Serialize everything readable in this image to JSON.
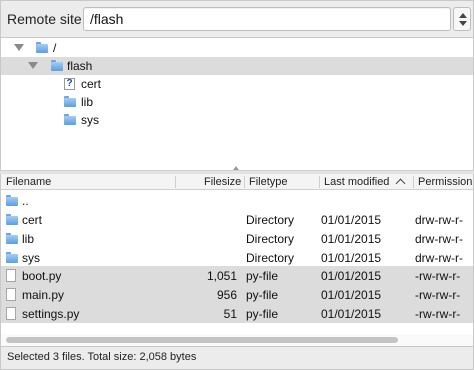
{
  "site_bar": {
    "label": "Remote site:",
    "path": "/flash"
  },
  "tree": {
    "items": [
      {
        "label": "/",
        "icon": "folder-icon",
        "expanded": true,
        "selected": false
      },
      {
        "label": "flash",
        "icon": "folder-icon",
        "expanded": true,
        "selected": true
      },
      {
        "label": "cert",
        "icon": "unknown-folder-icon",
        "expanded": false,
        "selected": false
      },
      {
        "label": "lib",
        "icon": "folder-icon",
        "expanded": false,
        "selected": false
      },
      {
        "label": "sys",
        "icon": "folder-icon",
        "expanded": false,
        "selected": false
      }
    ]
  },
  "file_list": {
    "columns": {
      "filename": "Filename",
      "filesize": "Filesize",
      "filetype": "Filetype",
      "last_modified": "Last modified",
      "permissions": "Permission"
    },
    "sort": {
      "column": "Last modified",
      "direction": "ascending"
    },
    "rows": [
      {
        "name": "..",
        "size": "",
        "type": "",
        "modified": "",
        "perms": "",
        "icon": "folder-icon",
        "selected": false
      },
      {
        "name": "cert",
        "size": "",
        "type": "Directory",
        "modified": "01/01/2015",
        "perms": "drw-rw-r-",
        "icon": "folder-icon",
        "selected": false
      },
      {
        "name": "lib",
        "size": "",
        "type": "Directory",
        "modified": "01/01/2015",
        "perms": "drw-rw-r-",
        "icon": "folder-icon",
        "selected": false
      },
      {
        "name": "sys",
        "size": "",
        "type": "Directory",
        "modified": "01/01/2015",
        "perms": "drw-rw-r-",
        "icon": "folder-icon",
        "selected": false
      },
      {
        "name": "boot.py",
        "size": "1,051",
        "type": "py-file",
        "modified": "01/01/2015",
        "perms": "-rw-rw-r-",
        "icon": "document-icon",
        "selected": true
      },
      {
        "name": "main.py",
        "size": "956",
        "type": "py-file",
        "modified": "01/01/2015",
        "perms": "-rw-rw-r-",
        "icon": "document-icon",
        "selected": true
      },
      {
        "name": "settings.py",
        "size": "51",
        "type": "py-file",
        "modified": "01/01/2015",
        "perms": "-rw-rw-r-",
        "icon": "document-icon",
        "selected": true
      }
    ]
  },
  "status": {
    "text": "Selected 3 files. Total size: 2,058 bytes"
  },
  "colors": {
    "selection": "#dcdcdc",
    "folder": "#5b9de0",
    "chrome": "#ececec"
  }
}
